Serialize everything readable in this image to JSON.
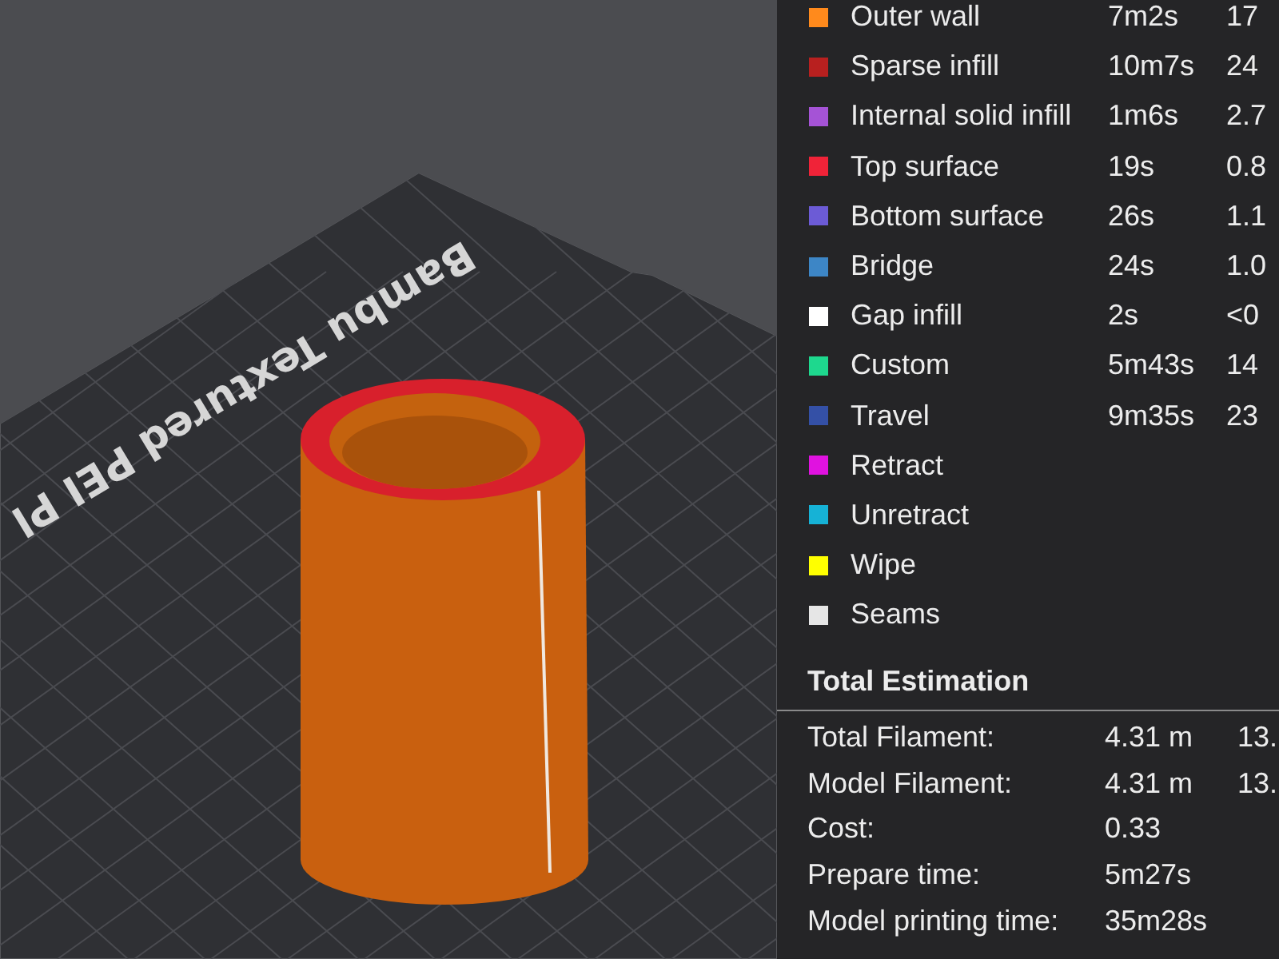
{
  "viewport": {
    "bed_label": "Bambu Textured PEI Pl"
  },
  "legend": [
    {
      "label": "Outer wall",
      "color": "#ff8a1c",
      "time": "7m2s",
      "percent": "17"
    },
    {
      "label": "Sparse infill",
      "color": "#b8201f",
      "time": "10m7s",
      "percent": "24"
    },
    {
      "label": "Internal solid infill",
      "color": "#a553d6",
      "time": "1m6s",
      "percent": "2.7"
    },
    {
      "label": "Top surface",
      "color": "#f02338",
      "time": "19s",
      "percent": "0.8"
    },
    {
      "label": "Bottom surface",
      "color": "#6c5bd6",
      "time": "26s",
      "percent": "1.1"
    },
    {
      "label": "Bridge",
      "color": "#3d86c6",
      "time": "24s",
      "percent": "1.0"
    },
    {
      "label": "Gap infill",
      "color": "#ffffff",
      "time": "2s",
      "percent": "<0"
    },
    {
      "label": "Custom",
      "color": "#1ed88e",
      "time": "5m43s",
      "percent": "14"
    },
    {
      "label": "Travel",
      "color": "#3450a6",
      "time": "9m35s",
      "percent": "23"
    },
    {
      "label": "Retract",
      "color": "#e012e0"
    },
    {
      "label": "Unretract",
      "color": "#16b2d6"
    },
    {
      "label": "Wipe",
      "color": "#ffff00"
    },
    {
      "label": "Seams",
      "color": "#e6e6e6"
    }
  ],
  "total_estimation": {
    "title": "Total Estimation",
    "rows": [
      {
        "label": "Total Filament:",
        "value": "4.31 m",
        "extra": "13."
      },
      {
        "label": "Model Filament:",
        "value": "4.31 m",
        "extra": "13."
      },
      {
        "label": "Cost:",
        "value": "0.33"
      },
      {
        "label": "Prepare time:",
        "value": "5m27s"
      },
      {
        "label": "Model printing time:",
        "value": "35m28s"
      }
    ]
  }
}
